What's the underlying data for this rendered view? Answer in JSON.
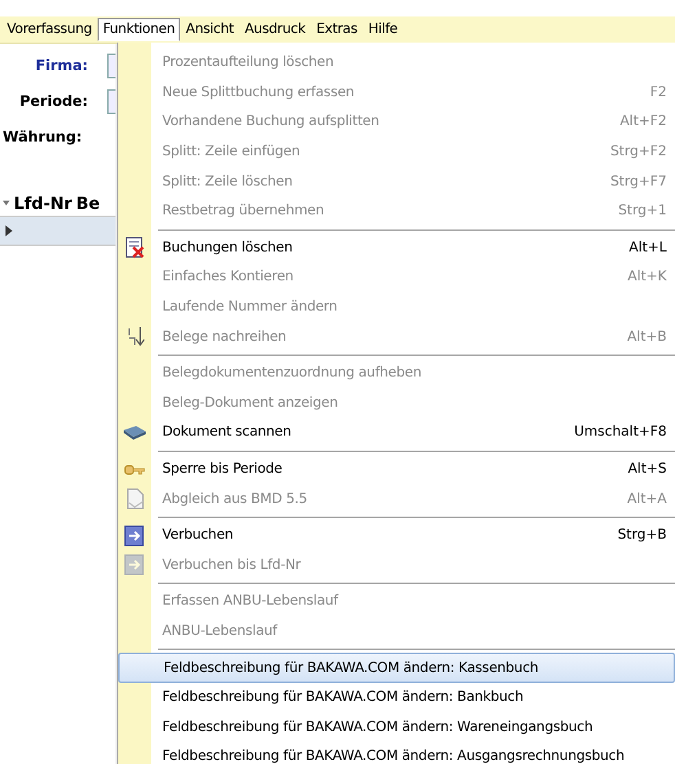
{
  "menubar": [
    {
      "label": "Vorerfassung",
      "selected": false
    },
    {
      "label": "Funktionen",
      "selected": true
    },
    {
      "label": "Ansicht",
      "selected": false
    },
    {
      "label": "Ausdruck",
      "selected": false
    },
    {
      "label": "Extras",
      "selected": false
    },
    {
      "label": "Hilfe",
      "selected": false
    }
  ],
  "form": {
    "fields": [
      {
        "label": "Firma:",
        "kind": "required"
      },
      {
        "label": "Periode:",
        "kind": "plain"
      },
      {
        "label": "Währung:",
        "kind": "plain"
      }
    ],
    "grid": {
      "columns": [
        "Lfd-Nr",
        "Be"
      ]
    }
  },
  "menu": {
    "groups": [
      [
        {
          "label": "Prozentaufteilung löschen",
          "disabled": true,
          "selected": false
        },
        {
          "label": "Neue Splittbuchung erfassen",
          "shortcut": "F2",
          "disabled": true,
          "selected": false
        },
        {
          "label": "Vorhandene Buchung aufsplitten",
          "shortcut": "Alt+F2",
          "disabled": true,
          "selected": false
        },
        {
          "label": "Splitt: Zeile einfügen",
          "shortcut": "Strg+F2",
          "disabled": true,
          "selected": false
        },
        {
          "label": "Splitt: Zeile löschen",
          "shortcut": "Strg+F7",
          "disabled": true,
          "selected": false
        },
        {
          "label": "Restbetrag übernehmen",
          "shortcut": "Strg+1",
          "disabled": true,
          "selected": false
        }
      ],
      [
        {
          "label": "Buchungen löschen",
          "shortcut": "Alt+L",
          "disabled": false,
          "selected": false,
          "kind": "delete"
        },
        {
          "label": "Einfaches Kontieren",
          "shortcut": "Alt+K",
          "disabled": true,
          "selected": false
        },
        {
          "label": "Laufende Nummer ändern",
          "disabled": true,
          "selected": false
        },
        {
          "label": "Belege nachreihen",
          "shortcut": "Alt+B",
          "disabled": true,
          "selected": false,
          "kind": "sort"
        }
      ],
      [
        {
          "label": "Belegdokumentenzuordnung aufheben",
          "disabled": true,
          "selected": false
        },
        {
          "label": "Beleg-Dokument anzeigen",
          "disabled": true,
          "selected": false
        },
        {
          "label": "Dokument scannen",
          "shortcut": "Umschalt+F8",
          "disabled": false,
          "selected": false,
          "kind": "scanner"
        }
      ],
      [
        {
          "label": "Sperre bis Periode",
          "shortcut": "Alt+S",
          "disabled": false,
          "selected": false,
          "kind": "key"
        },
        {
          "label": "Abgleich aus BMD 5.5",
          "shortcut": "Alt+A",
          "disabled": true,
          "selected": false,
          "kind": "document"
        }
      ],
      [
        {
          "label": "Verbuchen",
          "shortcut": "Strg+B",
          "disabled": false,
          "selected": false,
          "kind": "post"
        },
        {
          "label": "Verbuchen bis Lfd-Nr",
          "disabled": true,
          "selected": false,
          "kind": "post"
        }
      ],
      [
        {
          "label": "Erfassen ANBU-Lebenslauf",
          "disabled": true,
          "selected": false
        },
        {
          "label": "ANBU-Lebenslauf",
          "disabled": true,
          "selected": false
        }
      ],
      [
        {
          "label": "Feldbeschreibung für BAKAWA.COM ändern: Kassenbuch",
          "disabled": false,
          "selected": true
        },
        {
          "label": "Feldbeschreibung für BAKAWA.COM ändern: Bankbuch",
          "disabled": false,
          "selected": false
        },
        {
          "label": "Feldbeschreibung für BAKAWA.COM ändern: Wareneingangsbuch",
          "disabled": false,
          "selected": false
        },
        {
          "label": "Feldbeschreibung für BAKAWA.COM ändern: Ausgangsrechnungsbuch",
          "disabled": false,
          "selected": false
        }
      ]
    ]
  }
}
